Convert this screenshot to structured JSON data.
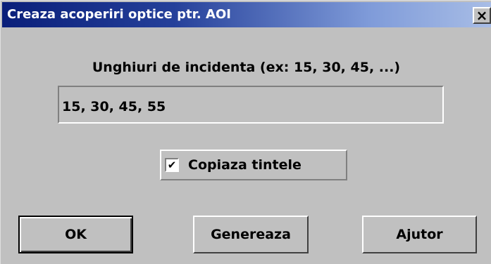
{
  "window": {
    "title": "Creaza acoperiri optice ptr. AOI",
    "close_glyph": "×"
  },
  "form": {
    "angles_label": "Unghiuri de incidenta (ex: 15, 30, 45, ...)",
    "angles_value": "15, 30, 45, 55",
    "copy_targets_label": "Copiaza tintele",
    "copy_targets_checked": true,
    "check_glyph": "✔"
  },
  "buttons": {
    "ok": "OK",
    "generate": "Genereaza",
    "help": "Ajutor"
  }
}
